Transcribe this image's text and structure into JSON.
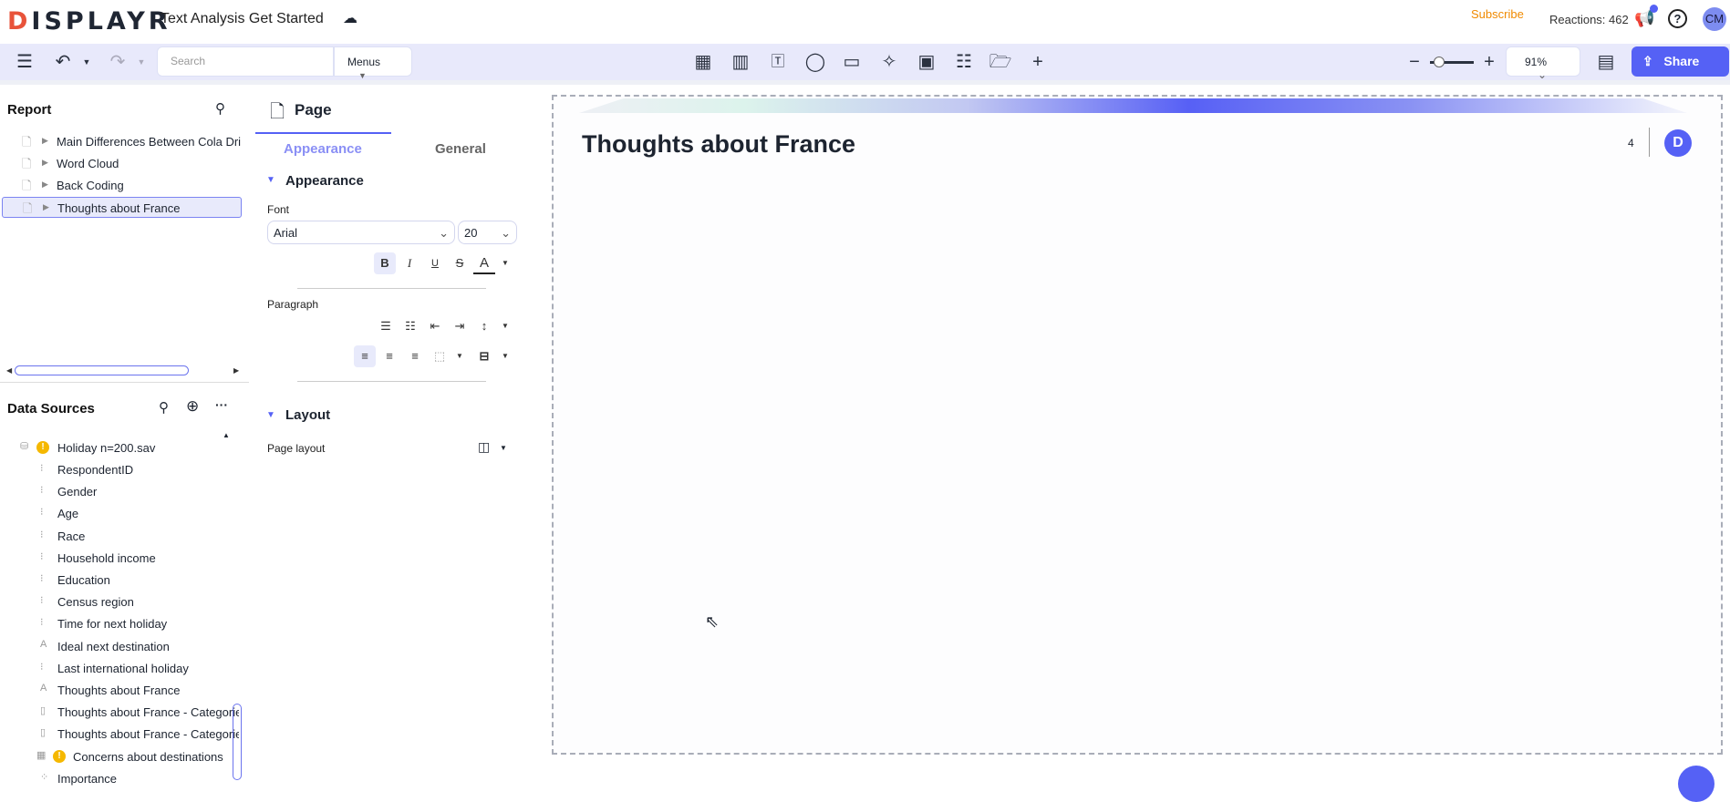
{
  "header": {
    "logo": "DISPLAYR",
    "doc_title": "Text Analysis Get Started",
    "subscribe": "Subscribe",
    "reactions": "Reactions: 462",
    "avatar": "CM"
  },
  "toolbar": {
    "search_placeholder": "Search",
    "menus": "Menus",
    "zoom": "91%",
    "share": "Share",
    "icons": [
      "table-icon",
      "chart-icon",
      "text-icon",
      "shape-icon",
      "image-icon",
      "sparkle-icon",
      "calculator-icon",
      "sliders-icon",
      "folder-icon",
      "plus-icon"
    ]
  },
  "report": {
    "title": "Report",
    "items": [
      {
        "label": "Main Differences Between Cola Drinks"
      },
      {
        "label": "Word Cloud"
      },
      {
        "label": "Back Coding"
      },
      {
        "label": "Thoughts about France",
        "selected": true
      }
    ]
  },
  "data_sources": {
    "title": "Data Sources",
    "file": "Holiday n=200.sav",
    "items": [
      {
        "label": "RespondentID",
        "type": "categorical"
      },
      {
        "label": "Gender",
        "type": "categorical"
      },
      {
        "label": "Age",
        "type": "categorical"
      },
      {
        "label": "Race",
        "type": "categorical"
      },
      {
        "label": "Household income",
        "type": "categorical"
      },
      {
        "label": "Education",
        "type": "categorical"
      },
      {
        "label": "Census region",
        "type": "categorical"
      },
      {
        "label": "Time for next holiday",
        "type": "categorical"
      },
      {
        "label": "Ideal next destination",
        "type": "text"
      },
      {
        "label": "Last international holiday",
        "type": "categorical"
      },
      {
        "label": "Thoughts about France",
        "type": "text"
      },
      {
        "label": "Thoughts about France - Categories",
        "type": "binary"
      },
      {
        "label": "Thoughts about France - Categories",
        "type": "binary"
      },
      {
        "label": "Concerns about destinations",
        "type": "grid",
        "warning": true
      },
      {
        "label": "Importance",
        "type": "multi"
      }
    ]
  },
  "properties": {
    "title": "Page",
    "tabs": [
      "Appearance",
      "General"
    ],
    "section_appearance": "Appearance",
    "font_label": "Font",
    "font": "Arial",
    "size": "20",
    "paragraph_label": "Paragraph",
    "section_layout": "Layout",
    "page_layout_label": "Page layout"
  },
  "page": {
    "title": "Thoughts about France",
    "page_number": "4",
    "badge": "D"
  }
}
